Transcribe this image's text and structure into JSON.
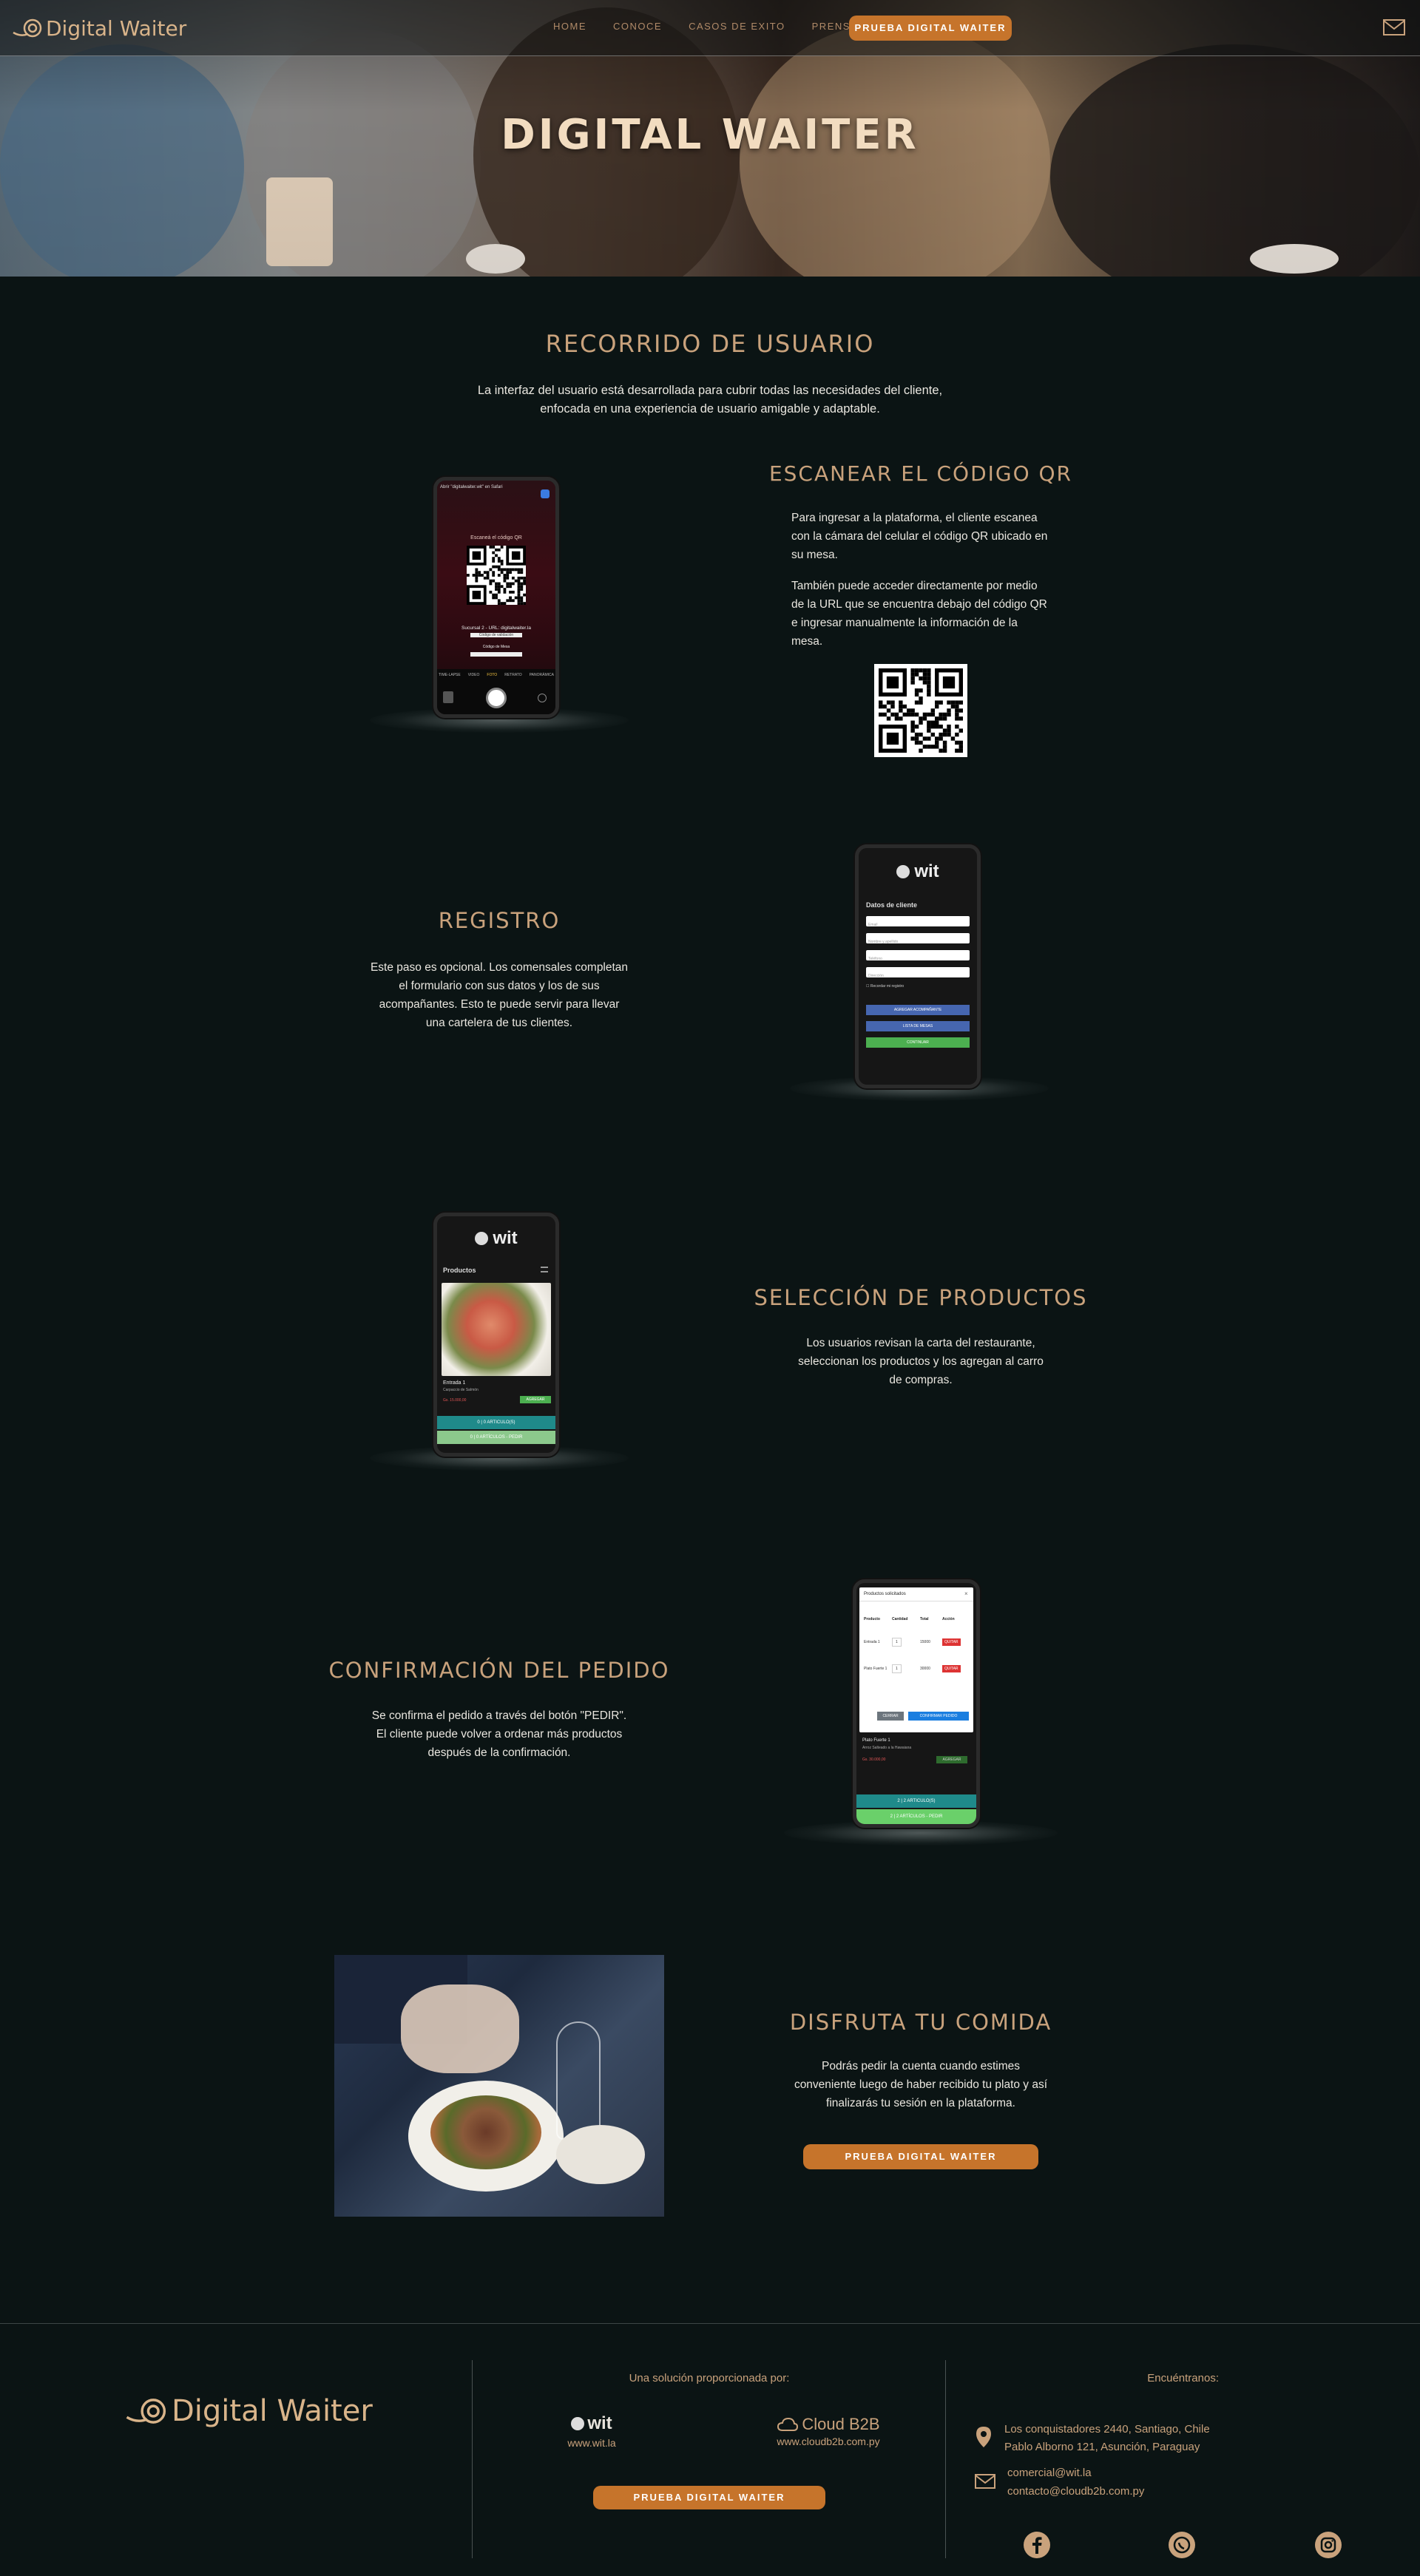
{
  "brand": "Digital Waiter",
  "nav": {
    "links": [
      "HOME",
      "CONOCE",
      "CASOS DE EXITO",
      "PRENSA"
    ],
    "cta": "PRUEBA DIGITAL WAITER"
  },
  "hero": {
    "title": "DIGITAL WAITER"
  },
  "intro": {
    "title": "RECORRIDO DE USUARIO",
    "text": "La interfaz del usuario está desarrollada para cubrir todas las necesidades del cliente, enfocada en una experiencia de usuario amigable y adaptable."
  },
  "steps": {
    "scan": {
      "title": "ESCANEAR EL CÓDIGO QR",
      "p1": "Para ingresar a la plataforma, el cliente escanea con la cámara del celular el código QR ubicado en su mesa.",
      "p2": "También puede acceder directamente por medio de la URL que se encuentra debajo del código QR e ingresar manualmente la información de la mesa."
    },
    "register": {
      "title": "REGISTRO",
      "text": "Este paso es opcional. Los comensales completan el formulario con sus datos y los de sus acompañantes. Esto te puede servir para llevar una cartelera de tus clientes."
    },
    "products": {
      "title": "SELECCIÓN DE PRODUCTOS",
      "text": "Los usuarios revisan la carta del restaurante, seleccionan los productos y los agregan al carro de compras."
    },
    "confirm": {
      "title": "CONFIRMACIÓN DEL PEDIDO",
      "text": "Se confirma el pedido a través del botón \"PEDIR\". El cliente puede volver a ordenar más productos después de la confirmación."
    },
    "enjoy": {
      "title": "DISFRUTA TU COMIDA",
      "text": "Podrás pedir la cuenta cuando estimes conveniente luego de haber recibido tu plato y así finalizarás tu sesión en la plataforma.",
      "cta": "PRUEBA DIGITAL WAITER"
    }
  },
  "phones": {
    "scan": {
      "status": "Abrir \"digitalwaiter.wit\" en Safari",
      "header": "Escaneá el código QR",
      "qr_caption": "Sucursal 2 - URL: digitalwaiter.la",
      "sub1": "Código de validación",
      "sub2": "Código de Mesa",
      "modes": [
        "TIME-LAPSE",
        "VIDEO",
        "FOTO",
        "RETRATO",
        "PANORÁMICA"
      ]
    },
    "register": {
      "logo": "wit",
      "heading": "Datos de cliente",
      "fields": [
        "Email",
        "Nombre y apellido",
        "Teléfono",
        "Dirección"
      ],
      "checkbox": "Recordar mi registro",
      "buttons": [
        "AGREGAR ACOMPAÑANTE",
        "LISTA DE MESAS",
        "CONTINUAR"
      ]
    },
    "products": {
      "logo": "wit",
      "heading": "Productos",
      "item": "Entrada 1",
      "desc": "Carpaccio de Salmón",
      "price": "Gs. 15.000,00",
      "add": "AGREGAR",
      "bar1": "0 | 0 ARTICULO(S)",
      "bar2": "0 | 0 ARTÍCULOS - PEDIR"
    },
    "confirm": {
      "modal_title": "Productos solicitados",
      "columns": [
        "Producto",
        "Cantidad",
        "Total",
        "Acción"
      ],
      "rows": [
        {
          "name": "Entrada 1",
          "qty": "1",
          "total": "15000",
          "action": "QUITAR"
        },
        {
          "name": "Plato Fuerte 1",
          "qty": "1",
          "total": "30000",
          "action": "QUITAR"
        }
      ],
      "close": "CERRAR",
      "confirm_btn": "CONFIRMAR PEDIDO",
      "behind_item": "Plato Fuerte 1",
      "behind_desc": "Arroz Salteado a la Hawaiana",
      "behind_price": "Gs. 30.000,00",
      "behind_add": "AGREGAR",
      "bar1": "2 | 2 ARTICULO(S)",
      "bar2": "2 | 2 ARTÍCULOS - PEDIR"
    }
  },
  "footer": {
    "brand": "Digital Waiter",
    "provided_by": "Una solución proporcionada por:",
    "partners": [
      {
        "name": "wit",
        "url": "www.wit.la"
      },
      {
        "name": "Cloud B2B",
        "url": "www.cloudb2b.com.py"
      }
    ],
    "cta": "PRUEBA DIGITAL WAITER",
    "find_us": "Encuéntranos:",
    "address1": "Los conquistadores 2440, Santiago, Chile",
    "address2": "Pablo Alborno 121, Asunción, Paraguay",
    "email1": "comercial@wit.la",
    "email2": "contacto@cloudb2b.com.py",
    "social_icons": [
      "facebook-icon",
      "whatsapp-icon",
      "instagram-icon"
    ]
  },
  "colors": {
    "accent": "#c6742b",
    "gold": "#c9a27c",
    "background": "#0b1414"
  }
}
